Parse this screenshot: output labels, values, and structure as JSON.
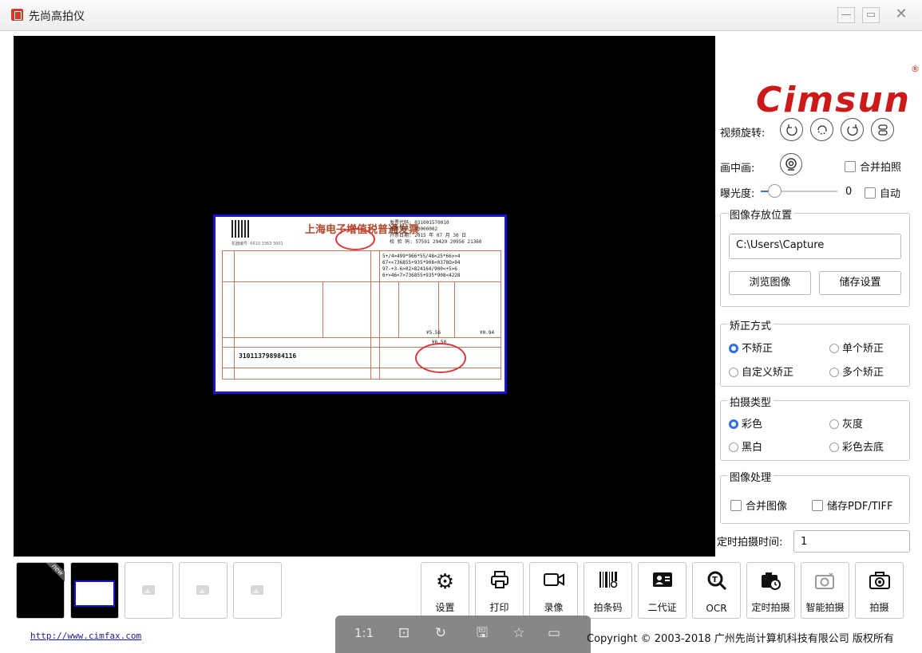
{
  "window": {
    "title": "先尚高拍仪",
    "controls": {
      "minimize": "—",
      "maximize": "▭",
      "close": "✕"
    }
  },
  "document_preview": {
    "invoice_title": "上海电子增值税普通发票",
    "machine_no": "机器编号: 6610 3363 3001",
    "code_lines": [
      "发票代码: 031001570010",
      "发票号码: 40000002",
      "开票日期: 2015 年 07 月 30 日",
      "校 验 码: 57591 29429 20956 21360"
    ],
    "cipher_lines": [
      "5+/4>499*966*55/48<25*66>>4",
      "67<<736855+935*908<0378O>94",
      "97-+3-6>02>824164/900<+5>6",
      "6+>46<7>736855+935*908<4228"
    ],
    "amount_left": "¥5.56",
    "amount_right": "¥0.94",
    "total": "¥6.50",
    "seller_tax_id": "310113798984116"
  },
  "sidebar": {
    "logo": "Cimsun",
    "logo_mark": "®",
    "rotate_label": "视频旋转:",
    "rotate_buttons": [
      "rotate-left-icon",
      "rotate-180-icon",
      "rotate-right-icon",
      "toggle-icon"
    ],
    "pip_label": "画中画:",
    "merge_photo_label": "合并拍照",
    "exposure_label": "曝光度:",
    "exposure_value": "0",
    "exposure_level": 0.13,
    "auto_label": "自动",
    "storage": {
      "legend": "图像存放位置",
      "path": "C:\\Users\\Capture",
      "browse_button": "浏览图像",
      "save_settings_button": "储存设置"
    },
    "correction": {
      "legend": "矫正方式",
      "options": [
        "不矫正",
        "单个矫正",
        "自定义矫正",
        "多个矫正"
      ],
      "selected": "不矫正"
    },
    "capture_type": {
      "legend": "拍摄类型",
      "options": [
        "彩色",
        "灰度",
        "黑白",
        "彩色去底"
      ],
      "selected": "彩色"
    },
    "image_processing": {
      "legend": "图像处理",
      "merge_images": "合并图像",
      "save_pdf_tiff": "储存PDF/TIFF"
    },
    "timer_label": "定时拍摄时间:",
    "timer_value": "1"
  },
  "toolbar": {
    "settings": "设置",
    "print": "打印",
    "record": "录像",
    "barcode": "拍条码",
    "id_card": "二代证",
    "ocr": "OCR",
    "timed_capture": "定时拍摄",
    "smart_capture": "智能拍摄",
    "capture": "拍摄"
  },
  "thumbnails": {
    "new_badge": "new"
  },
  "view_bar": {
    "one_to_one": "1:1"
  },
  "footer": {
    "link": "http://www.cimfax.com",
    "copyright": "Copyright © 2003-2018 广州先尚计算机科技有限公司 版权所有"
  }
}
